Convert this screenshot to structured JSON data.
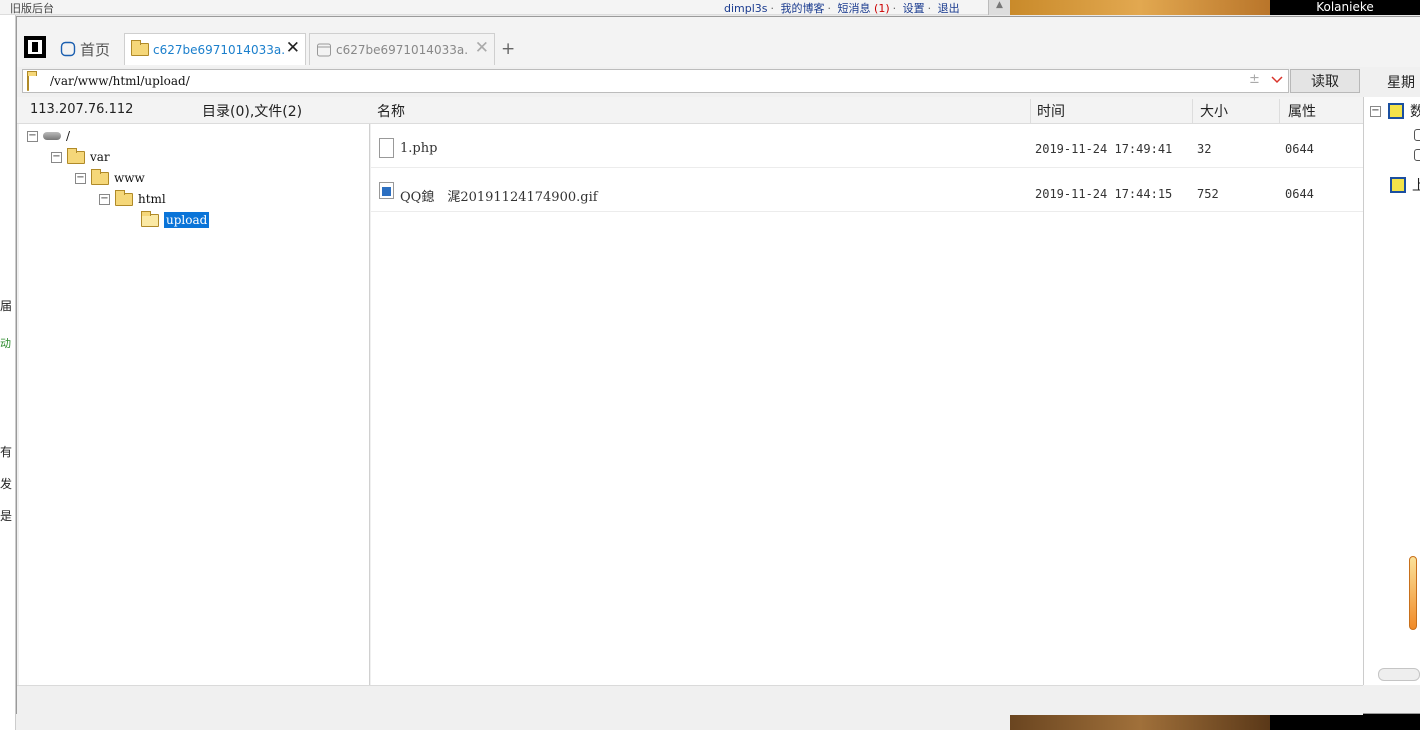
{
  "background": {
    "top_left_text": "旧版后台",
    "username": "dimpl3s",
    "links": [
      "我的博客",
      "短消息",
      "设置",
      "退出"
    ],
    "message_count": "(1)",
    "black_box_text": "Kolanieke",
    "side_chars": [
      "届",
      "动",
      "有",
      "发",
      "是"
    ]
  },
  "tabs": {
    "home_label": "首页",
    "items": [
      {
        "label": "c627be6971014033a.",
        "active": true
      },
      {
        "label": "c627be6971014033a.",
        "active": false
      }
    ],
    "add_label": "+"
  },
  "path": {
    "value": "/var/www/html/upload/",
    "plus": "±",
    "read_button": "读取",
    "weekday": "星期"
  },
  "header": {
    "ip": "113.207.76.112",
    "summary": "目录(0),文件(2)",
    "col_name": "名称",
    "col_time": "时间",
    "col_size": "大小",
    "col_attr": "属性"
  },
  "tree": [
    {
      "name": "/",
      "toggle": "−",
      "type": "drive"
    },
    {
      "name": "var",
      "toggle": "−",
      "type": "folder"
    },
    {
      "name": "www",
      "toggle": "−",
      "type": "folder"
    },
    {
      "name": "html",
      "toggle": "−",
      "type": "folder"
    },
    {
      "name": "upload",
      "toggle": "",
      "type": "folder-open",
      "selected": true
    }
  ],
  "files": [
    {
      "name": "1.php",
      "time": "2019-11-24 17:49:41",
      "size": "32",
      "attr": "0644",
      "icon": "file-icon"
    },
    {
      "name": "QQ鎴　浘20191124174900.gif",
      "time": "2019-11-24 17:44:15",
      "size": "752",
      "attr": "0644",
      "icon": "image-file-icon"
    }
  ],
  "right_panel": {
    "row1_text": "数",
    "row4_text": "上"
  },
  "colors": {
    "accent_blue": "#1b7fcc",
    "selection_blue": "#0a74d8",
    "folder_yellow": "#f5d779"
  }
}
